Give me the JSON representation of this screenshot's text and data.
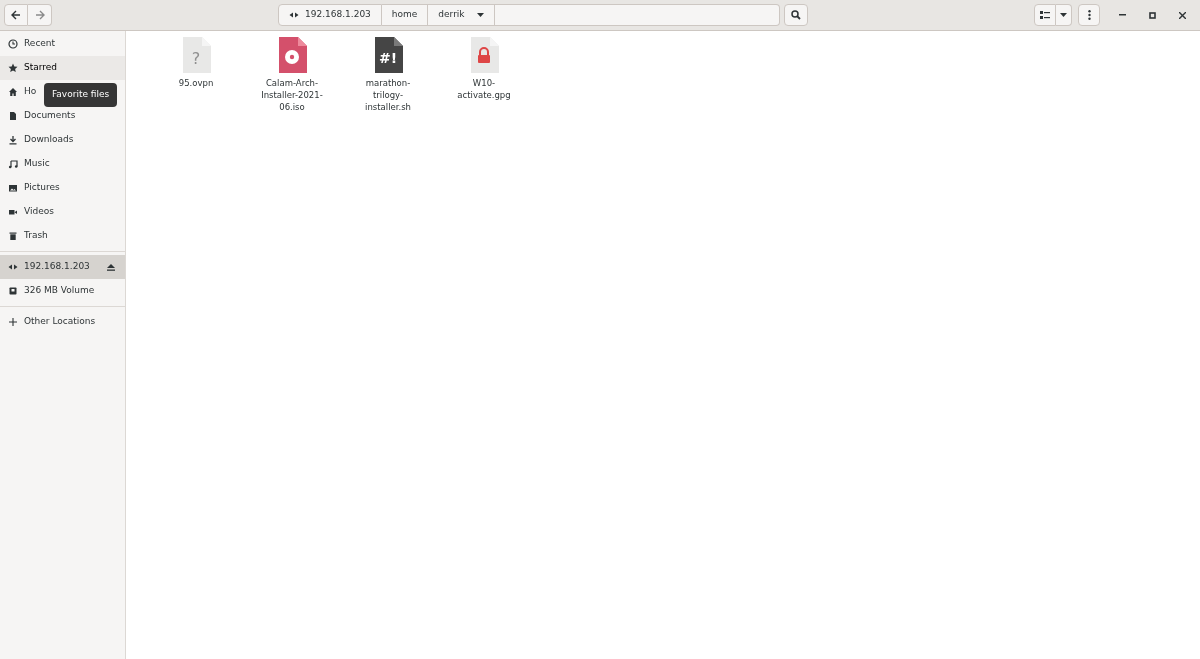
{
  "path_bar": [
    {
      "kind": "network",
      "label": "192.168.1.203"
    },
    {
      "kind": "folder",
      "label": "home"
    },
    {
      "kind": "current",
      "label": "derrik"
    }
  ],
  "sidebar": {
    "sections": [
      [
        {
          "kind": "recent",
          "label": "Recent",
          "selected": false,
          "hovered": false
        },
        {
          "kind": "star",
          "label": "Starred",
          "selected": false,
          "hovered": true
        },
        {
          "kind": "home",
          "label": "Ho",
          "selected": false,
          "hovered": false
        },
        {
          "kind": "document",
          "label": "Documents",
          "selected": false,
          "hovered": false
        },
        {
          "kind": "download",
          "label": "Downloads",
          "selected": false,
          "hovered": false
        },
        {
          "kind": "music",
          "label": "Music",
          "selected": false,
          "hovered": false
        },
        {
          "kind": "picture",
          "label": "Pictures",
          "selected": false,
          "hovered": false
        },
        {
          "kind": "video",
          "label": "Videos",
          "selected": false,
          "hovered": false
        },
        {
          "kind": "trash",
          "label": "Trash",
          "selected": false,
          "hovered": false
        }
      ],
      [
        {
          "kind": "network",
          "label": "192.168.1.203",
          "selected": true,
          "hovered": false,
          "eject": true
        },
        {
          "kind": "drive",
          "label": "326 MB Volume",
          "selected": false,
          "hovered": false
        }
      ],
      [
        {
          "kind": "plus",
          "label": "Other Locations",
          "selected": false,
          "hovered": false
        }
      ]
    ]
  },
  "tooltip": "Favorite files",
  "files": [
    {
      "kind": "unknown",
      "glyph": "?",
      "name": "95.ovpn"
    },
    {
      "kind": "disc",
      "name": "Calam-Arch-Installer-2021-06.iso"
    },
    {
      "kind": "script",
      "glyph": "#!",
      "name": "marathon-trilogy-installer.sh"
    },
    {
      "kind": "locked",
      "name": "W10-activate.gpg"
    }
  ]
}
